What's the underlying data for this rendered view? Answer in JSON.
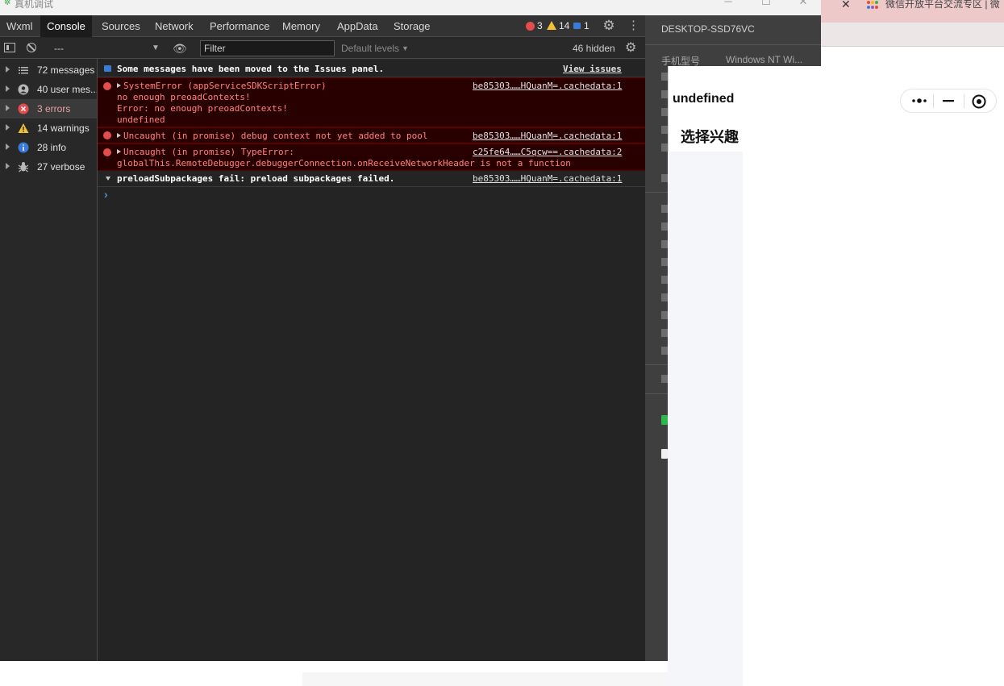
{
  "window": {
    "title": "真机调试"
  },
  "background_browser": {
    "tab_text": "微信开放平台交流专区 | 微"
  },
  "devtools": {
    "tabs": [
      {
        "label": "Wxml"
      },
      {
        "label": "Console",
        "active": true
      },
      {
        "label": "Sources"
      },
      {
        "label": "Network"
      },
      {
        "label": "Performance"
      },
      {
        "label": "Memory"
      },
      {
        "label": "AppData"
      },
      {
        "label": "Storage"
      }
    ],
    "counts": {
      "errors": "3",
      "warnings": "14",
      "info": "1"
    },
    "toolbar": {
      "context": "---",
      "filter_placeholder": "Filter",
      "levels": "Default levels",
      "hidden": "46 hidden"
    },
    "sidebar": [
      {
        "label": "72 messages",
        "icon": "list-icon"
      },
      {
        "label": "40 user mes...",
        "icon": "user-icon"
      },
      {
        "label": "3 errors",
        "icon": "error-icon",
        "selected": true
      },
      {
        "label": "14 warnings",
        "icon": "warning-icon"
      },
      {
        "label": "28 info",
        "icon": "info-icon"
      },
      {
        "label": "27 verbose",
        "icon": "bug-icon"
      }
    ],
    "messages": {
      "issues_notice": "Some messages have been moved to the Issues panel.",
      "view_issues": "View issues",
      "m1_line1": "SystemError (appServiceSDKScriptError)",
      "m1_line2": "no enough preoadContexts!",
      "m1_line3": "Error: no enough preoadContexts!",
      "m1_line4": "undefined",
      "m1_src": "be85303……HQuanM=.cachedata:1",
      "m2_line1": "Uncaught (in promise) debug context not yet added to pool",
      "m2_src": "be85303……HQuanM=.cachedata:1",
      "m3_line1": "Uncaught (in promise) TypeError:",
      "m3_line2": "globalThis.RemoteDebugger.debuggerConnection.onReceiveNetworkHeader is not a function",
      "m3_src": "c25fe64……C5qcw==.cachedata:2",
      "m4_line1": "preloadSubpackages fail: preload subpackages failed.",
      "m4_src": "be85303……HQuanM=.cachedata:1",
      "prompt": "›"
    }
  },
  "info_panel": {
    "device": "DESKTOP-SSD76VC",
    "phone_model_label": "手机型号",
    "phone_model_value": "Windows NT Wi..."
  },
  "phone": {
    "nav_title": "undefined",
    "page_heading": "选择兴趣"
  },
  "colors": {
    "error": "#e34d4d",
    "warning": "#f2c037",
    "info": "#3a7bd5",
    "devtools_bg": "#242424",
    "error_row_bg": "#290000"
  }
}
